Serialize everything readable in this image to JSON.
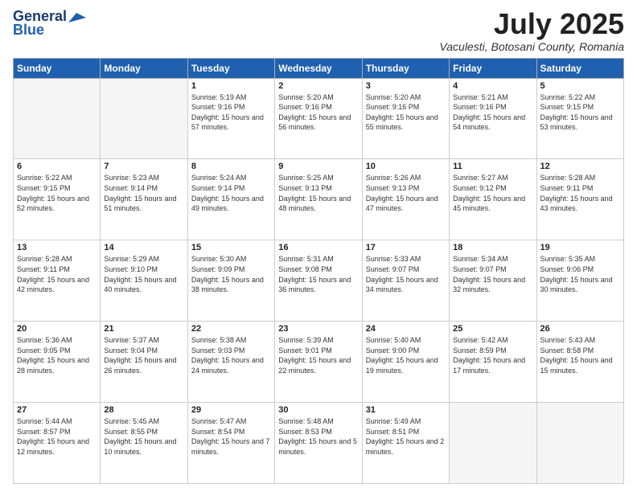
{
  "logo": {
    "general": "General",
    "blue": "Blue"
  },
  "title": {
    "month": "July 2025",
    "location": "Vaculesti, Botosani County, Romania"
  },
  "headers": [
    "Sunday",
    "Monday",
    "Tuesday",
    "Wednesday",
    "Thursday",
    "Friday",
    "Saturday"
  ],
  "weeks": [
    [
      {
        "day": "",
        "info": ""
      },
      {
        "day": "",
        "info": ""
      },
      {
        "day": "1",
        "info": "Sunrise: 5:19 AM\nSunset: 9:16 PM\nDaylight: 15 hours and 57 minutes."
      },
      {
        "day": "2",
        "info": "Sunrise: 5:20 AM\nSunset: 9:16 PM\nDaylight: 15 hours and 56 minutes."
      },
      {
        "day": "3",
        "info": "Sunrise: 5:20 AM\nSunset: 9:16 PM\nDaylight: 15 hours and 55 minutes."
      },
      {
        "day": "4",
        "info": "Sunrise: 5:21 AM\nSunset: 9:16 PM\nDaylight: 15 hours and 54 minutes."
      },
      {
        "day": "5",
        "info": "Sunrise: 5:22 AM\nSunset: 9:15 PM\nDaylight: 15 hours and 53 minutes."
      }
    ],
    [
      {
        "day": "6",
        "info": "Sunrise: 5:22 AM\nSunset: 9:15 PM\nDaylight: 15 hours and 52 minutes."
      },
      {
        "day": "7",
        "info": "Sunrise: 5:23 AM\nSunset: 9:14 PM\nDaylight: 15 hours and 51 minutes."
      },
      {
        "day": "8",
        "info": "Sunrise: 5:24 AM\nSunset: 9:14 PM\nDaylight: 15 hours and 49 minutes."
      },
      {
        "day": "9",
        "info": "Sunrise: 5:25 AM\nSunset: 9:13 PM\nDaylight: 15 hours and 48 minutes."
      },
      {
        "day": "10",
        "info": "Sunrise: 5:26 AM\nSunset: 9:13 PM\nDaylight: 15 hours and 47 minutes."
      },
      {
        "day": "11",
        "info": "Sunrise: 5:27 AM\nSunset: 9:12 PM\nDaylight: 15 hours and 45 minutes."
      },
      {
        "day": "12",
        "info": "Sunrise: 5:28 AM\nSunset: 9:11 PM\nDaylight: 15 hours and 43 minutes."
      }
    ],
    [
      {
        "day": "13",
        "info": "Sunrise: 5:28 AM\nSunset: 9:11 PM\nDaylight: 15 hours and 42 minutes."
      },
      {
        "day": "14",
        "info": "Sunrise: 5:29 AM\nSunset: 9:10 PM\nDaylight: 15 hours and 40 minutes."
      },
      {
        "day": "15",
        "info": "Sunrise: 5:30 AM\nSunset: 9:09 PM\nDaylight: 15 hours and 38 minutes."
      },
      {
        "day": "16",
        "info": "Sunrise: 5:31 AM\nSunset: 9:08 PM\nDaylight: 15 hours and 36 minutes."
      },
      {
        "day": "17",
        "info": "Sunrise: 5:33 AM\nSunset: 9:07 PM\nDaylight: 15 hours and 34 minutes."
      },
      {
        "day": "18",
        "info": "Sunrise: 5:34 AM\nSunset: 9:07 PM\nDaylight: 15 hours and 32 minutes."
      },
      {
        "day": "19",
        "info": "Sunrise: 5:35 AM\nSunset: 9:06 PM\nDaylight: 15 hours and 30 minutes."
      }
    ],
    [
      {
        "day": "20",
        "info": "Sunrise: 5:36 AM\nSunset: 9:05 PM\nDaylight: 15 hours and 28 minutes."
      },
      {
        "day": "21",
        "info": "Sunrise: 5:37 AM\nSunset: 9:04 PM\nDaylight: 15 hours and 26 minutes."
      },
      {
        "day": "22",
        "info": "Sunrise: 5:38 AM\nSunset: 9:03 PM\nDaylight: 15 hours and 24 minutes."
      },
      {
        "day": "23",
        "info": "Sunrise: 5:39 AM\nSunset: 9:01 PM\nDaylight: 15 hours and 22 minutes."
      },
      {
        "day": "24",
        "info": "Sunrise: 5:40 AM\nSunset: 9:00 PM\nDaylight: 15 hours and 19 minutes."
      },
      {
        "day": "25",
        "info": "Sunrise: 5:42 AM\nSunset: 8:59 PM\nDaylight: 15 hours and 17 minutes."
      },
      {
        "day": "26",
        "info": "Sunrise: 5:43 AM\nSunset: 8:58 PM\nDaylight: 15 hours and 15 minutes."
      }
    ],
    [
      {
        "day": "27",
        "info": "Sunrise: 5:44 AM\nSunset: 8:57 PM\nDaylight: 15 hours and 12 minutes."
      },
      {
        "day": "28",
        "info": "Sunrise: 5:45 AM\nSunset: 8:55 PM\nDaylight: 15 hours and 10 minutes."
      },
      {
        "day": "29",
        "info": "Sunrise: 5:47 AM\nSunset: 8:54 PM\nDaylight: 15 hours and 7 minutes."
      },
      {
        "day": "30",
        "info": "Sunrise: 5:48 AM\nSunset: 8:53 PM\nDaylight: 15 hours and 5 minutes."
      },
      {
        "day": "31",
        "info": "Sunrise: 5:49 AM\nSunset: 8:51 PM\nDaylight: 15 hours and 2 minutes."
      },
      {
        "day": "",
        "info": ""
      },
      {
        "day": "",
        "info": ""
      }
    ]
  ]
}
